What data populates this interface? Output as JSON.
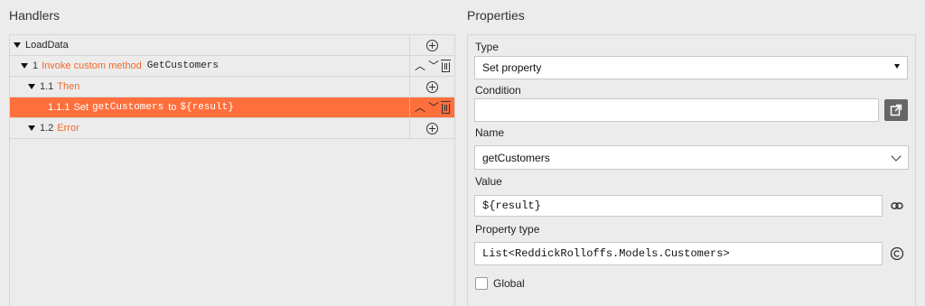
{
  "handlers": {
    "title": "Handlers",
    "rows": [
      {
        "num": "",
        "label": "LoadData"
      },
      {
        "num": "1",
        "label": "Invoke custom method",
        "method": "GetCustomers"
      },
      {
        "num": "1.1",
        "label": "Then"
      },
      {
        "num": "1.1.1",
        "label": "Set",
        "target": "getCustomers",
        "to": "to",
        "value": "${result}"
      },
      {
        "num": "1.2",
        "label": "Error"
      }
    ]
  },
  "properties": {
    "title": "Properties",
    "type_label": "Type",
    "type_value": "Set property",
    "condition_label": "Condition",
    "condition_value": "",
    "name_label": "Name",
    "name_value": "getCustomers",
    "value_label": "Value",
    "value_value": "${result}",
    "property_type_label": "Property type",
    "property_type_value": "List<ReddickRolloffs.Models.Customers>",
    "global_label": "Global"
  },
  "colors": {
    "accent": "#ff6f3c",
    "link": "#f06a2e"
  }
}
